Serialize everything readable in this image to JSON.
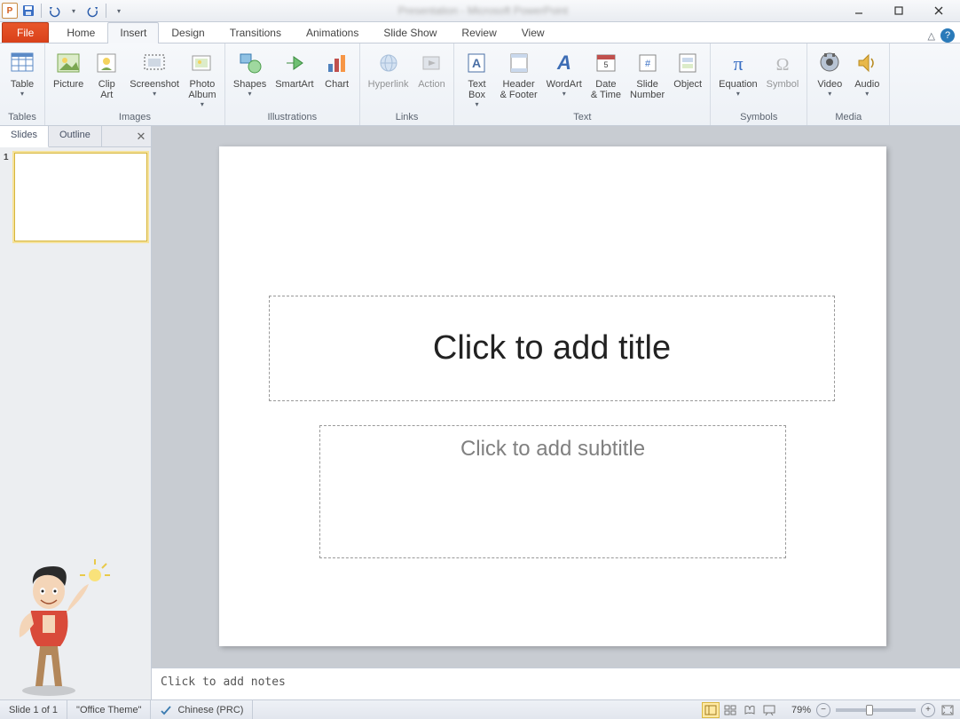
{
  "quickAccess": {
    "saveTip": "Save",
    "undoTip": "Undo",
    "redoTip": "Redo"
  },
  "windowControls": {
    "min": "Minimize",
    "max": "Maximize",
    "close": "Close"
  },
  "tabs": {
    "file": "File",
    "home": "Home",
    "insert": "Insert",
    "design": "Design",
    "transitions": "Transitions",
    "animations": "Animations",
    "slideshow": "Slide Show",
    "review": "Review",
    "view": "View",
    "active": "insert"
  },
  "ribbon": {
    "groups": {
      "tables": {
        "label": "Tables",
        "table": "Table"
      },
      "images": {
        "label": "Images",
        "picture": "Picture",
        "clipart": "Clip\nArt",
        "screenshot": "Screenshot",
        "album": "Photo\nAlbum"
      },
      "illustrations": {
        "label": "Illustrations",
        "shapes": "Shapes",
        "smartart": "SmartArt",
        "chart": "Chart"
      },
      "links": {
        "label": "Links",
        "hyperlink": "Hyperlink",
        "action": "Action"
      },
      "text": {
        "label": "Text",
        "textbox": "Text\nBox",
        "header": "Header\n& Footer",
        "wordart": "WordArt",
        "date": "Date\n& Time",
        "slidenum": "Slide\nNumber",
        "object": "Object"
      },
      "symbols": {
        "label": "Symbols",
        "equation": "Equation",
        "symbol": "Symbol"
      },
      "media": {
        "label": "Media",
        "video": "Video",
        "audio": "Audio"
      }
    }
  },
  "leftPane": {
    "tabSlides": "Slides",
    "tabOutline": "Outline",
    "slideNum": "1"
  },
  "slide": {
    "titlePlaceholder": "Click to add title",
    "subtitlePlaceholder": "Click to add subtitle"
  },
  "notes": {
    "placeholder": "Click to add notes"
  },
  "status": {
    "slideInfo": "Slide 1 of 1",
    "theme": "\"Office Theme\"",
    "language": "Chinese (PRC)",
    "zoom": "79%",
    "zoomValue": 79
  }
}
